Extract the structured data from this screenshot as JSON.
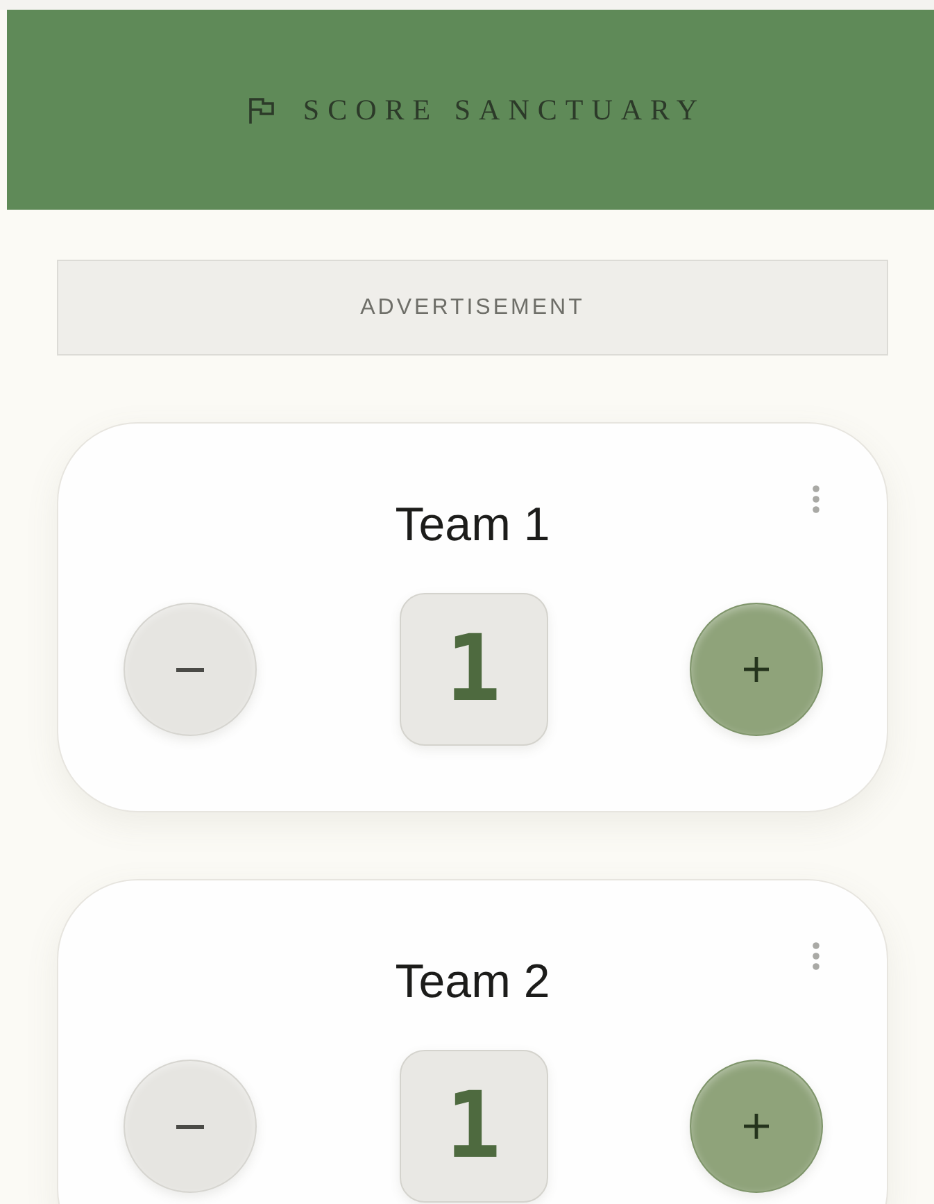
{
  "header": {
    "title": "SCORE SANCTUARY"
  },
  "advertisement": {
    "label": "ADVERTISEMENT"
  },
  "teams": [
    {
      "name": "Team 1",
      "score": "1"
    },
    {
      "name": "Team 2",
      "score": "1"
    }
  ]
}
